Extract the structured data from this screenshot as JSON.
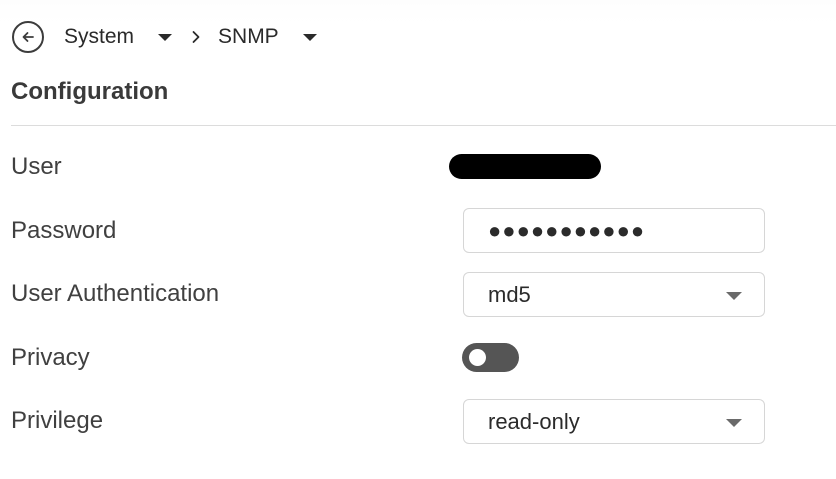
{
  "breadcrumb": {
    "back_icon": "arrow-left-circle-icon",
    "items": [
      {
        "label": "System"
      },
      {
        "label": "SNMP"
      }
    ],
    "separator_icon": "chevron-right-icon"
  },
  "section": {
    "title": "Configuration"
  },
  "form": {
    "user": {
      "label": "User"
    },
    "password": {
      "label": "Password",
      "value": "●●●●●●●●●●●"
    },
    "user_authentication": {
      "label": "User Authentication",
      "value": "md5"
    },
    "privacy": {
      "label": "Privacy",
      "enabled": false
    },
    "privilege": {
      "label": "Privilege",
      "value": "read-only"
    }
  },
  "colors": {
    "toggle_off": "#555555",
    "text": "#3a3a3a",
    "divider": "#dcdcdc"
  }
}
